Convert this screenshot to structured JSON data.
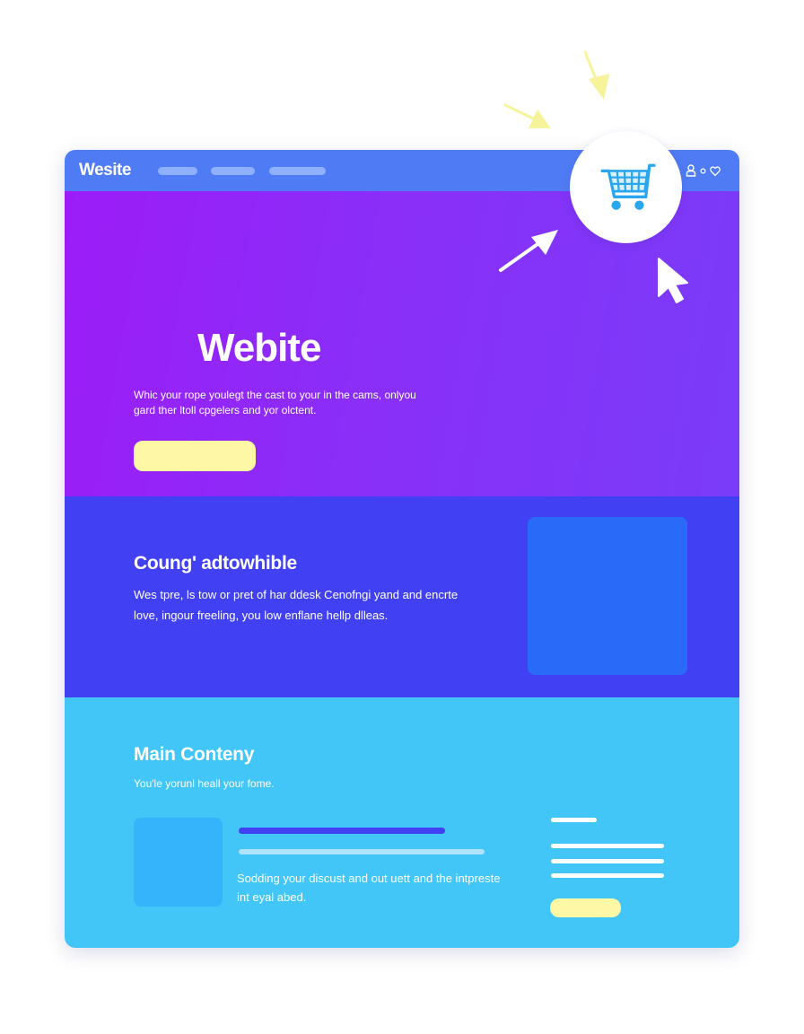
{
  "colors": {
    "nav_bg": "#4f7cf5",
    "hero_start": "#9c1cf7",
    "hero_end": "#7a3cf8",
    "feature_bg": "#4140f3",
    "main_bg": "#41c6f7",
    "accent_yellow": "#fdf7a6",
    "cart_blue": "#2aa6ee"
  },
  "nav": {
    "brand": "Wesite",
    "icons": [
      "user-icon",
      "dot-icon",
      "heart-icon"
    ]
  },
  "cart": {
    "icon": "shopping-cart-icon"
  },
  "hero": {
    "title": "Webite",
    "text": "Whic your rope youlegt the cast to your in the cams, onlyou gard ther ltoll cpgelers and yor olctent."
  },
  "feature": {
    "title": "Coung' adtowhible",
    "text": "Wes tpre, ls tow or pret of har ddesk Cenofngi yand and encrte love, ingour freeling, you low enflane hellp dlleas."
  },
  "main": {
    "title": "Main Conteny",
    "subtitle": "You'le yorunl heall your fome.",
    "card_text": "Sodding your discust and out uett and the intpreste int eyal abed."
  }
}
